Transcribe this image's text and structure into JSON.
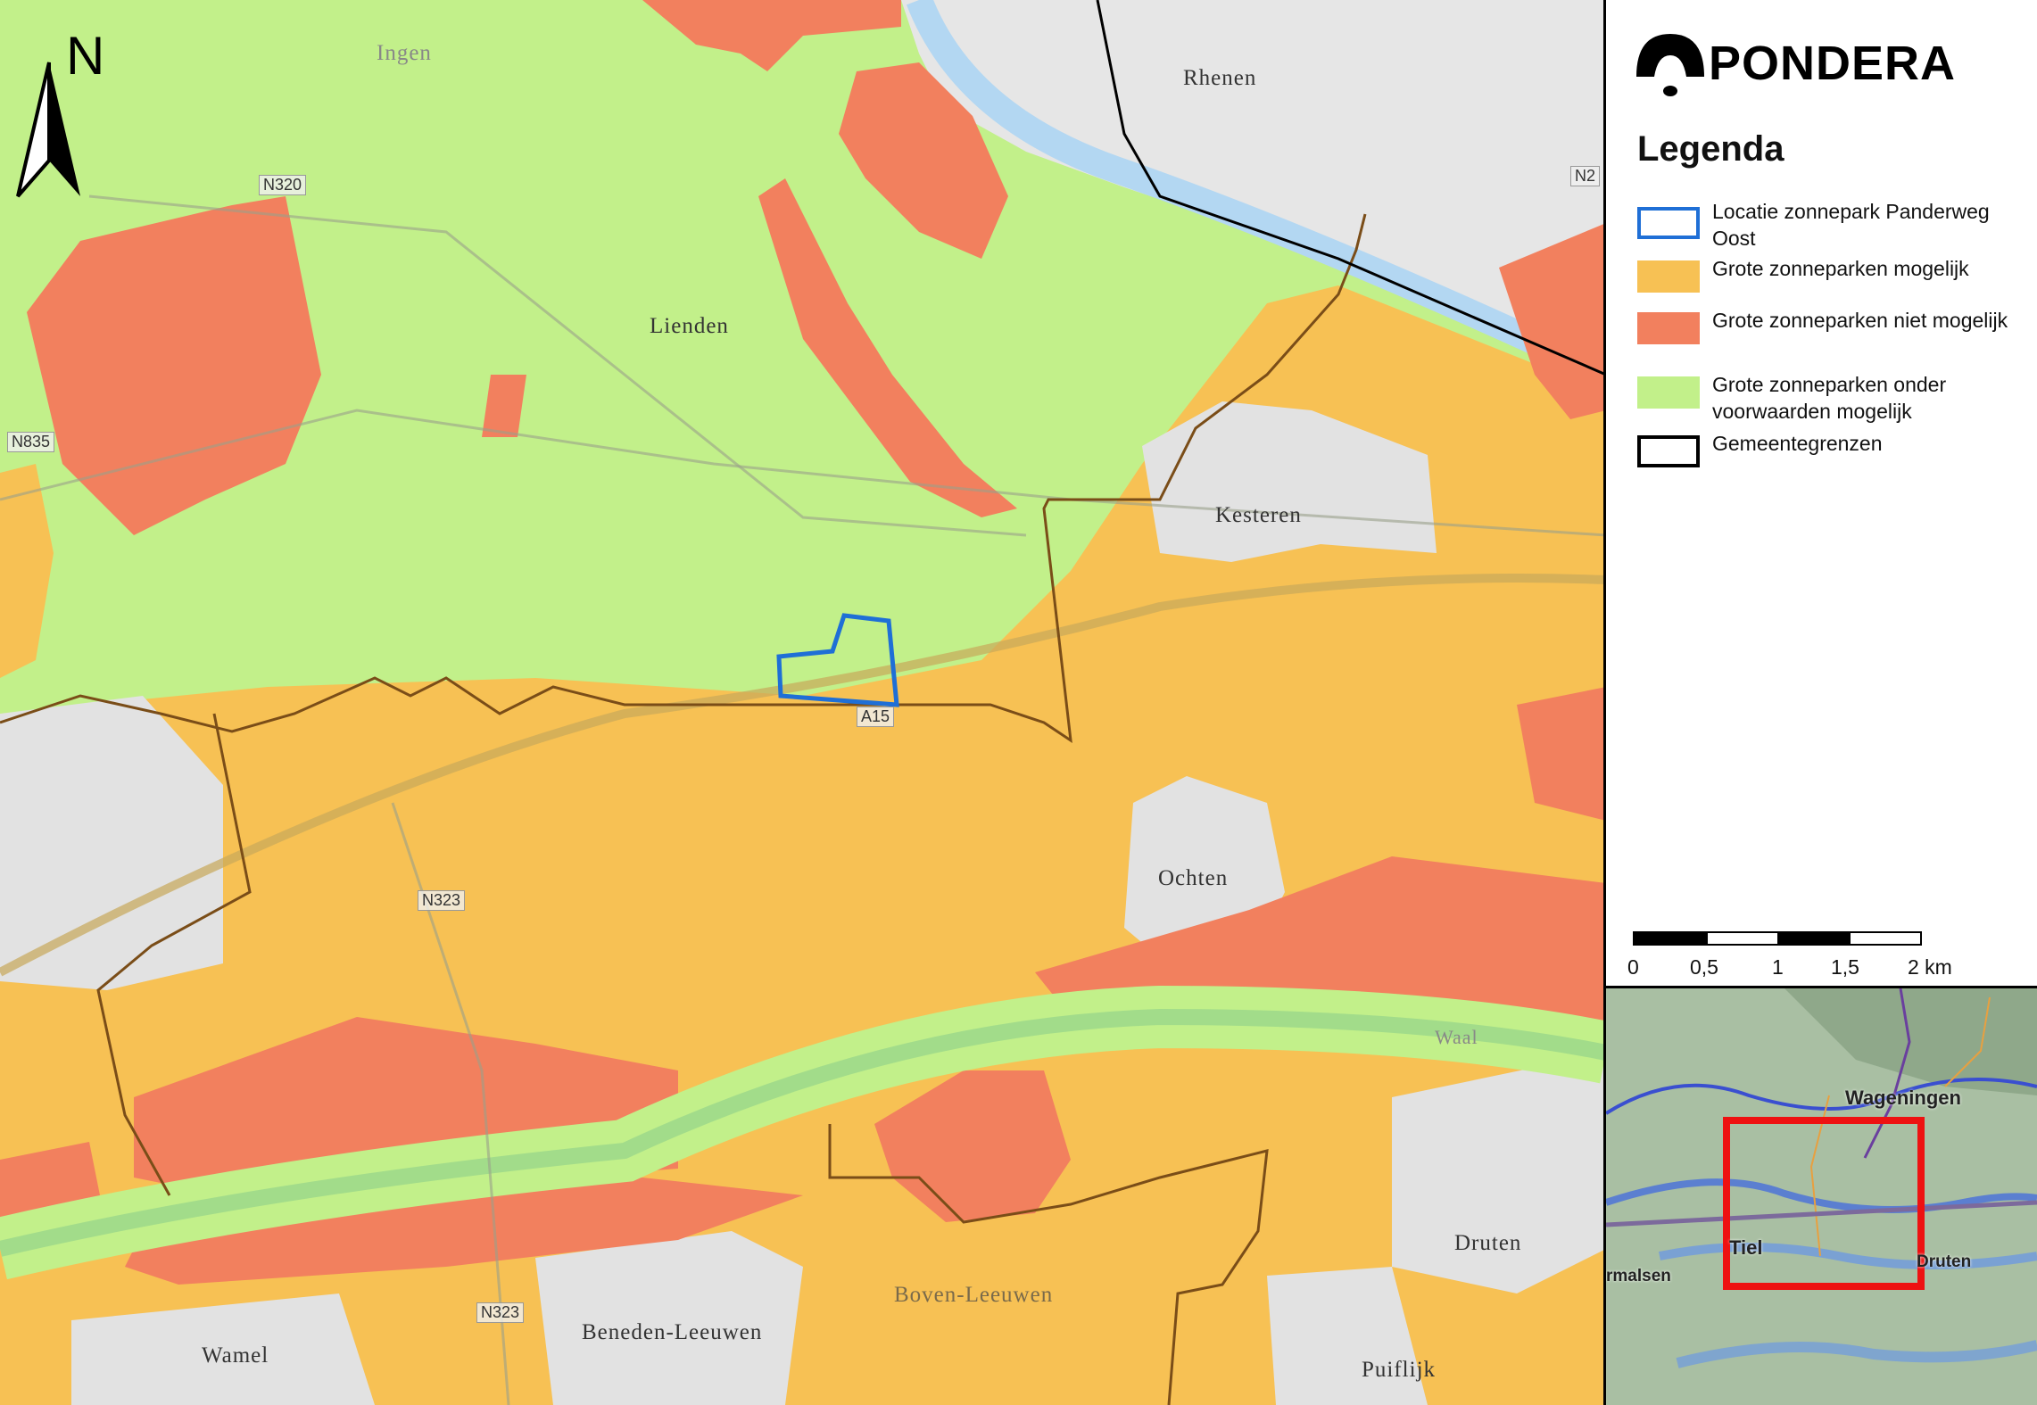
{
  "north_arrow": {
    "label": "N"
  },
  "places": {
    "ingen": "Ingen",
    "rhenen": "Rhenen",
    "lienden": "Lienden",
    "kesteren": "Kesteren",
    "ochten": "Ochten",
    "druten": "Druten",
    "boven_leeuwen": "Boven-Leeuwen",
    "beneden_leeuwen": "Beneden-Leeuwen",
    "wamel": "Wamel",
    "puiflijk": "Puiflijk",
    "waal": "Waal"
  },
  "roads": {
    "n320": "N320",
    "n835": "N835",
    "n323_a": "N323",
    "n323_b": "N323",
    "a15": "A15",
    "n2": "N2"
  },
  "brand": {
    "name": "PONDERA"
  },
  "legend": {
    "title": "Legenda",
    "items": [
      {
        "label": "Locatie zonnepark Panderweg Oost",
        "color": "#1f6fd6"
      },
      {
        "label": "Grote zonneparken mogelijk",
        "color": "#f7c154"
      },
      {
        "label": "Grote zonneparken niet mogelijk",
        "color": "#f2805e"
      },
      {
        "label": "Grote zonneparken onder voorwaarden mogelijk",
        "color": "#c2f08a"
      },
      {
        "label": "Gemeentegrenzen",
        "color": "#000000"
      }
    ]
  },
  "scalebar": {
    "ticks": [
      "0",
      "0,5",
      "1",
      "1,5",
      "2 km"
    ]
  },
  "inset": {
    "places": {
      "wageningen": "Wageningen",
      "tiel": "Tiel",
      "druten": "Druten",
      "geldermalsen": "rmalsen"
    },
    "frame_color": "#ee1111"
  }
}
